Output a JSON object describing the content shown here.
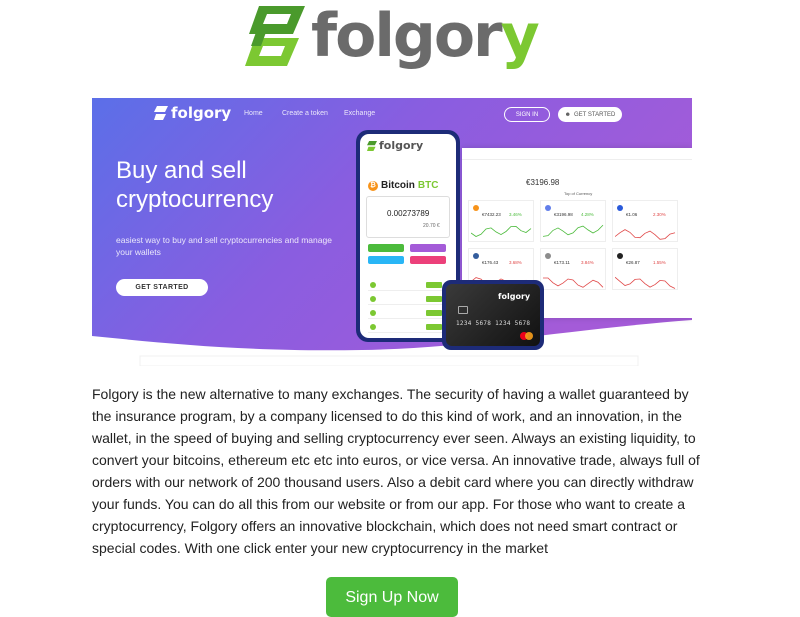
{
  "brand": {
    "name_main": "folgor",
    "name_accent": "y",
    "accent_color": "#7cc832",
    "text_color": "#6b6b6b"
  },
  "hero": {
    "nav": {
      "logo": "folgory",
      "links": [
        "Home",
        "Create a token",
        "Exchange"
      ],
      "sign_in": "SIGN IN",
      "get_started": "GET STARTED"
    },
    "title": "Buy and sell cryptocurrency",
    "subtitle": "easiest way to buy and sell cryptocurrencies and manage your wallets",
    "cta": "GET STARTED",
    "gradient": [
      "#5b6fe8",
      "#8a5de0",
      "#a45bd8"
    ],
    "dashboard": {
      "price": "€3196.98",
      "section_label": "Top of Currency",
      "tiles": [
        {
          "value": "€7432.23",
          "change": "3.46%",
          "color": "#f7931a",
          "up": true
        },
        {
          "value": "€3196.98",
          "change": "4.28%",
          "color": "#627eea",
          "up": true
        },
        {
          "value": "€1.06",
          "change": "2.30%",
          "color": "#2a5ada",
          "up": false
        },
        {
          "value": "€176.43",
          "change": "3.68%",
          "color": "#345d9d",
          "up": false
        },
        {
          "value": "€173.11",
          "change": "3.84%",
          "color": "#8c8c8c",
          "up": false
        },
        {
          "value": "€26.87",
          "change": "1.55%",
          "color": "#222222",
          "up": false
        }
      ]
    },
    "phone": {
      "logo": "folgory",
      "coin": "Bitcoin",
      "coin_symbol": "BTC",
      "amount": "0.00273789",
      "amount_eur": "20.70 €"
    },
    "card": {
      "logo": "folgory",
      "number": "1234 5678 1234 5678"
    }
  },
  "body": {
    "paragraph": "Folgory is the new alternative to many exchanges. The security of having a wallet guaranteed by the insurance program, by a company licensed to do this kind of work, and an innovation, in the wallet, in the speed of buying and selling cryptocurrency ever seen. Always an existing liquidity, to convert your bitcoins, ethereum etc etc into euros, or vice versa. An innovative trade, always full of orders with our network of 200 thousand users. Also a debit card where you can directly withdraw your funds. You can do all this from our website or from our app. For those who want to create a cryptocurrency, Folgory offers an innovative blockchain, which does not need smart contract or special codes. With one click enter your new cryptocurrency in the market"
  },
  "signup": {
    "label": "Sign Up Now",
    "color": "#4cbb3c"
  }
}
